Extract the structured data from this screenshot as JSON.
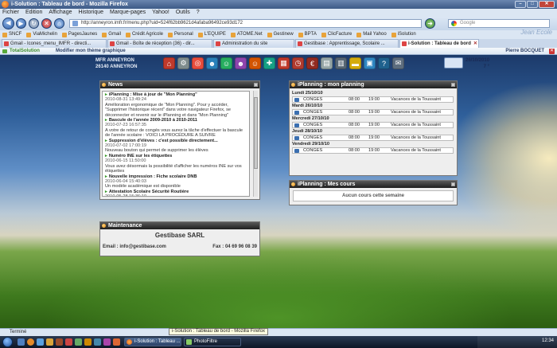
{
  "browser": {
    "title": "i-Solution : Tableau de bord - Mozilla Firefox",
    "menu": [
      "Fichier",
      "Edition",
      "Affichage",
      "Historique",
      "Marque-pages",
      "Yahoo!",
      "Outils",
      "?"
    ],
    "url": "http://anneyron.imfr.fr/menu.php?uid=524f62bb9621d4afaba96492ce93d172",
    "search_placeholder": "Google",
    "watermark": "Jean Ecole",
    "bookmarks": [
      "SNCF",
      "ViaMichelin",
      "PagesJaunes",
      "Gmail",
      "Crédit Agricole",
      "Personal",
      "L'EQUIPE",
      "ATOME.Net",
      "Gestinew",
      "BPTA",
      "ClicFacture",
      "Mail Yahoo",
      "iSolution"
    ],
    "tabs": [
      {
        "label": "Gmail - Icones_menu_IMFR - directi...",
        "active": false
      },
      {
        "label": "Gmail - Boîte de réception (36) - dir...",
        "active": false
      },
      {
        "label": "Administration du site",
        "active": false
      },
      {
        "label": "Gestibase : Apprentissage, Scolaire ...",
        "active": false
      },
      {
        "label": "i-Solution : Tableau de bord",
        "active": true
      }
    ],
    "status": "Terminé",
    "tooltip": "i-Solution : Tableau de bord - Mozilla Firefox"
  },
  "app": {
    "brand": "TotalSolution",
    "theme_link": "Modifier mon thème graphique",
    "user": "Pierre BOCQUET",
    "school_line1": "MFR ANNEYRON",
    "school_line2": "26140 ANNEYRON",
    "date": "26/10/2010",
    "date_sub": "7 °",
    "toolbar_icons": [
      {
        "name": "home-icon",
        "glyph": "⌂",
        "color": "#c0392b"
      },
      {
        "name": "gear-icon",
        "glyph": "⚙",
        "color": "#7f8c8d"
      },
      {
        "name": "lifebuoy-icon",
        "glyph": "◎",
        "color": "#e74c3c"
      },
      {
        "name": "group-icon",
        "glyph": "☻",
        "color": "#2980b9"
      },
      {
        "name": "user-icon",
        "glyph": "☺",
        "color": "#27ae60"
      },
      {
        "name": "users-icon",
        "glyph": "☻",
        "color": "#8e44ad"
      },
      {
        "name": "person-icon",
        "glyph": "☺",
        "color": "#d35400"
      },
      {
        "name": "user-add-icon",
        "glyph": "✚",
        "color": "#16a085"
      },
      {
        "name": "calendar-icon",
        "glyph": "▦",
        "color": "#c0392b"
      },
      {
        "name": "clock-icon",
        "glyph": "◷",
        "color": "#b03a2e"
      },
      {
        "name": "euro-icon",
        "glyph": "€",
        "color": "#922b21"
      },
      {
        "name": "document-icon",
        "glyph": "▤",
        "color": "#95a5a6"
      },
      {
        "name": "printer-icon",
        "glyph": "▥",
        "color": "#566573"
      },
      {
        "name": "folder-icon",
        "glyph": "▬",
        "color": "#d4ac0d"
      },
      {
        "name": "window-icon",
        "glyph": "▣",
        "color": "#2e86c1"
      },
      {
        "name": "help-icon",
        "glyph": "?",
        "color": "#1f618d"
      },
      {
        "name": "mail-icon",
        "glyph": "✉",
        "color": "#5d6d7e"
      }
    ]
  },
  "news": {
    "title": "News",
    "items": [
      {
        "title": "iPlanning : Mise à jour de \"Mon Planning\"",
        "date": "2010-08-31 13:49:24",
        "body": "Amélioration ergonomique de \"Mon Planning\". Pour y accéder, \"Supprimer l'historique récent\" dans votre navigateur Firefox, se déconnecter et revenir sur le iPlanning et dans \"Mon Planning\""
      },
      {
        "title": "Bascule de l'année 2009-2010 à 2010-2011",
        "date": "2010-07-23 16:57:35",
        "body": "A votre de retour de congés vous aurez la tâche d'effectuer la bascule de l'année scolaire : VOICI LA PROCÉDURE A SUIVRE"
      },
      {
        "title": "Suppression d'élèves : c'est possible directement...",
        "date": "2010-07-02 17:00:19",
        "body": "Nouveau bouton qui permet de supprimer les élèves"
      },
      {
        "title": "Numéro INE sur les étiquettes",
        "date": "2010-06-15 11:50:00",
        "body": "Vous avez désormais la possibilité d'afficher les numéros INE sur vos étiquettes"
      },
      {
        "title": "Nouvelle impression : Fiche scolaire DNB",
        "date": "2010-06-04 15:40:03",
        "body": "Un modèle académique est disponible"
      },
      {
        "title": "Attestation Scolaire Sécurité Routière",
        "date": "2010-05-28 15:36:10",
        "body": "Une nouvelle impression est disponible, elle correspond au 3 niveaux ASSR."
      },
      {
        "title": "Nouvelle impression du planning de cours :",
        "date": "2010-05-27 17:15:24",
        "body": ""
      }
    ]
  },
  "maintenance": {
    "title": "Maintenance",
    "company": "Gestibase SARL",
    "email": "Email : info@gestibase.com",
    "phone": "Fax : 04 69 96 08 39"
  },
  "planning": {
    "title": "iPlanning : mon planning",
    "days": [
      {
        "day": "Lundi 25/10/10",
        "code": "CONGES",
        "start": "08:00",
        "end": "19:00",
        "desc": "Vacances de la Toussaint"
      },
      {
        "day": "Mardi 26/10/10",
        "code": "CONGES",
        "start": "08:00",
        "end": "19:00",
        "desc": "Vacances de la Toussaint"
      },
      {
        "day": "Mercredi 27/10/10",
        "code": "CONGES",
        "start": "08:00",
        "end": "19:00",
        "desc": "Vacances de la Toussaint"
      },
      {
        "day": "Jeudi 28/10/10",
        "code": "CONGES",
        "start": "08:00",
        "end": "19:00",
        "desc": "Vacances de la Toussaint"
      },
      {
        "day": "Vendredi 29/10/10",
        "code": "CONGES",
        "start": "08:00",
        "end": "19:00",
        "desc": "Vacances de la Toussaint"
      }
    ]
  },
  "cours": {
    "title": "iPlanning : Mes cours",
    "empty": "Aucun cours cette semaine"
  },
  "taskbar": {
    "tasks": [
      {
        "label": "i-Solution : Tableau ...",
        "active": true
      },
      {
        "label": "PhotoFiltre",
        "active": false
      }
    ],
    "clock": "12:34"
  }
}
